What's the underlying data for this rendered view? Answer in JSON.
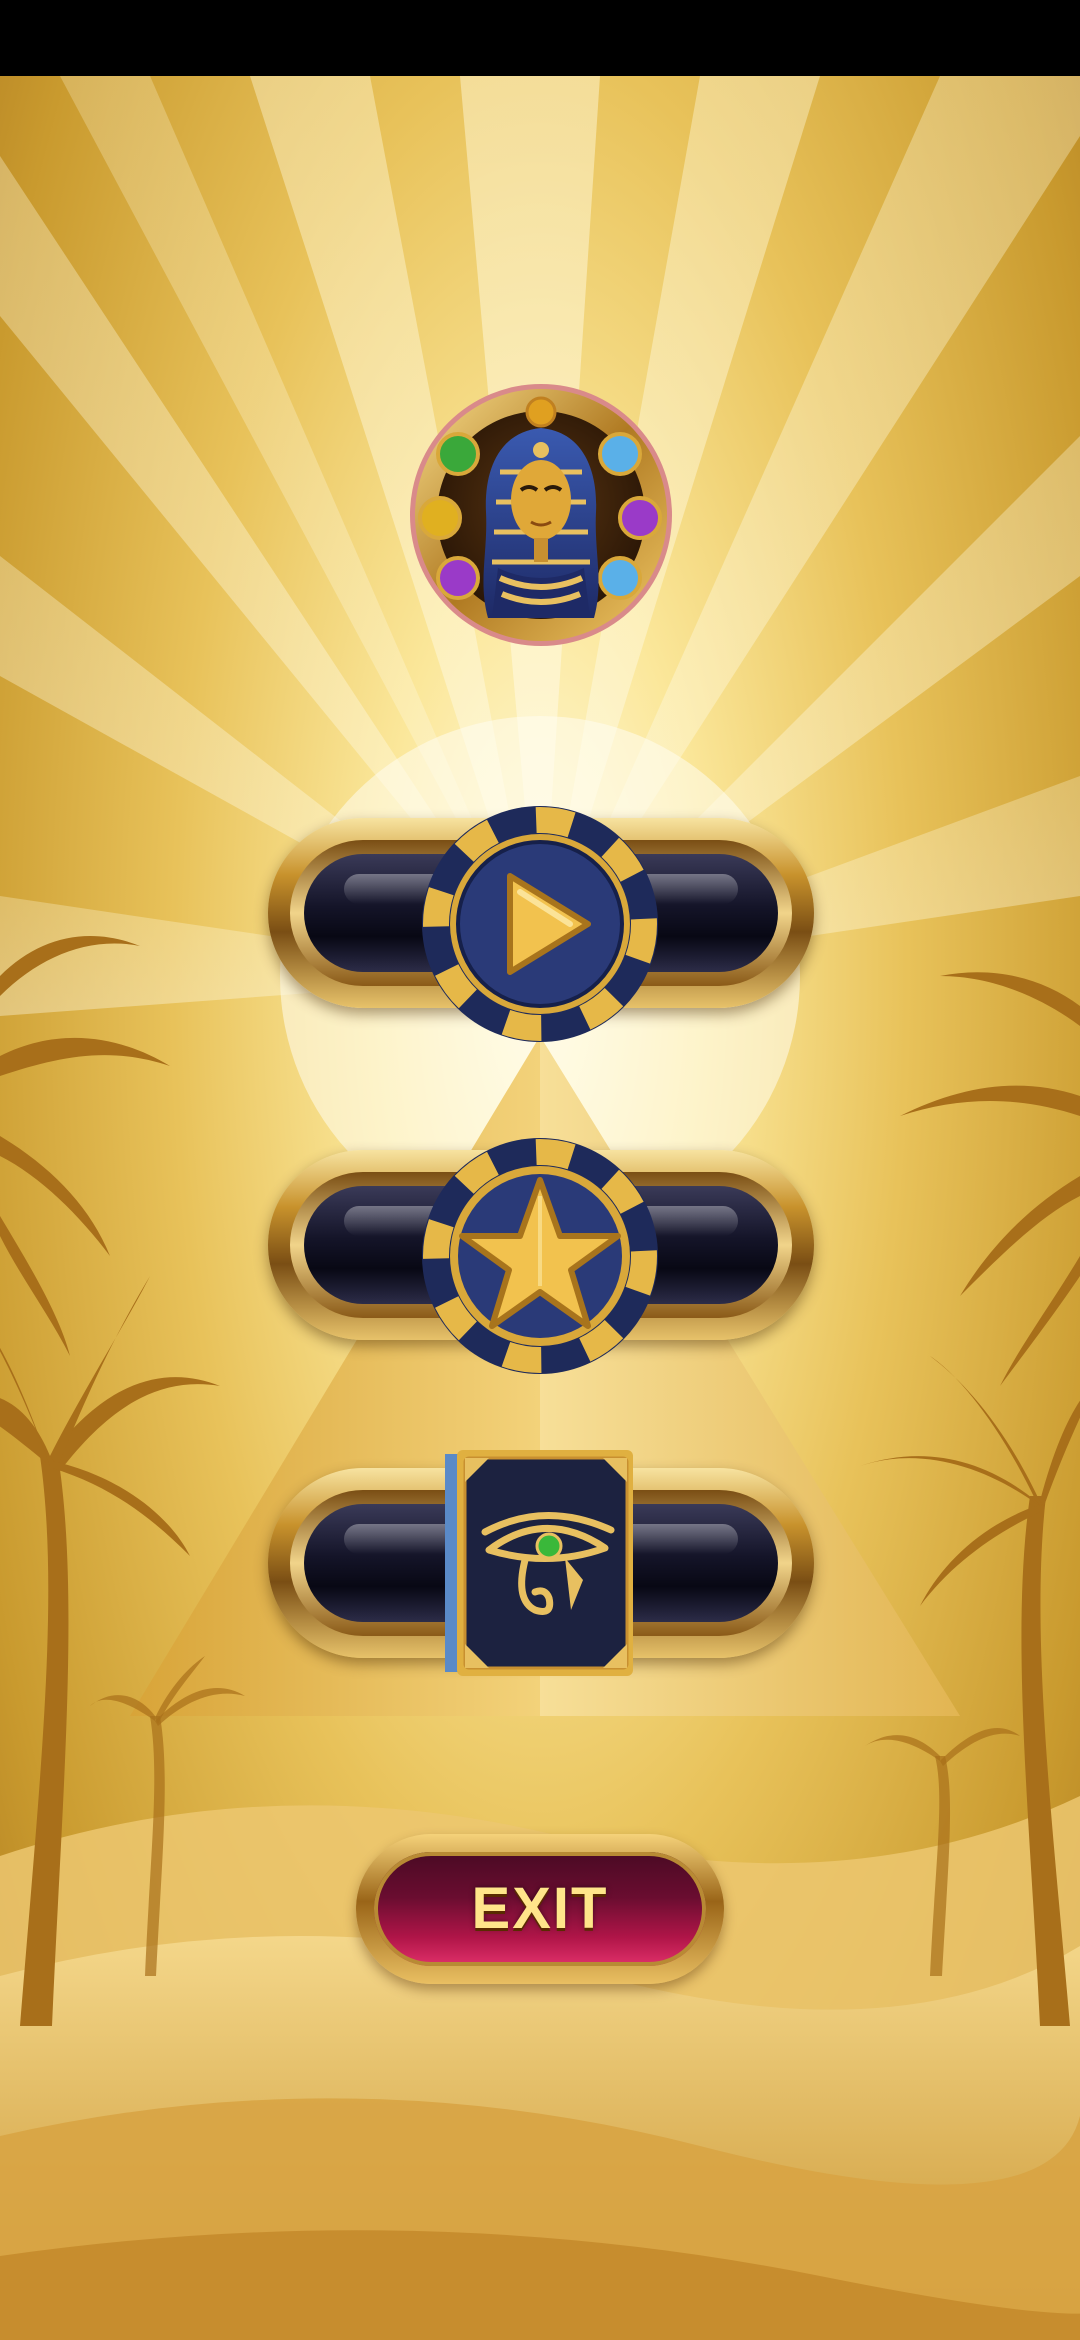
{
  "status_bar": {},
  "logo": {
    "icon": "pharaoh-medallion-icon"
  },
  "menu": {
    "play": {
      "icon": "play-icon"
    },
    "rate": {
      "icon": "star-icon"
    },
    "rules": {
      "icon": "eye-of-horus-book-icon"
    },
    "exit": {
      "label": "EXIT"
    }
  },
  "colors": {
    "gold": "#e8b84a",
    "navy": "#1e2a5a",
    "exit_red": "#b01548",
    "sky_light": "#fff6cc"
  }
}
